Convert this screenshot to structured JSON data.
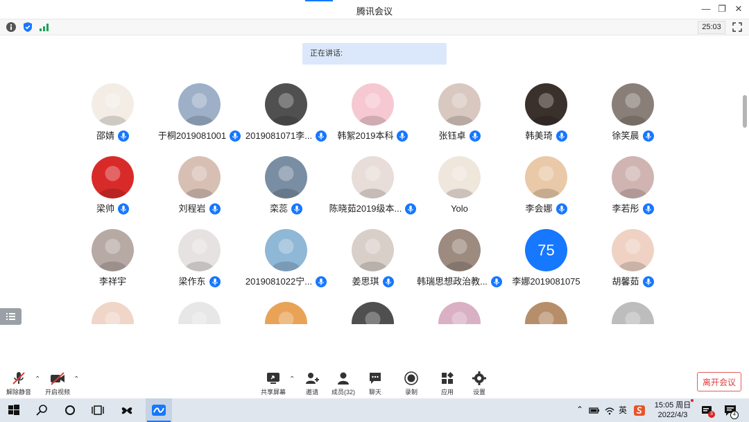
{
  "window": {
    "title": "腾讯会议"
  },
  "infobar": {
    "timer": "25:03"
  },
  "speaking": {
    "label": "正在讲话:"
  },
  "participants": [
    {
      "name": "邵婧",
      "mic": true,
      "avatar": "#f3ede6"
    },
    {
      "name": "于桐2019081001",
      "mic": true,
      "avatar": "#9db0c8"
    },
    {
      "name": "2019081071李...",
      "mic": true,
      "avatar": "#505050"
    },
    {
      "name": "韩絮2019本科",
      "mic": true,
      "avatar": "#f6c9d2"
    },
    {
      "name": "张钰卓",
      "mic": true,
      "avatar": "#d9c8c0"
    },
    {
      "name": "韩美琦",
      "mic": true,
      "avatar": "#3a302c"
    },
    {
      "name": "徐笑晨",
      "mic": true,
      "avatar": "#8a7f78"
    },
    {
      "name": "梁帅",
      "mic": true,
      "avatar": "#d92a2a"
    },
    {
      "name": "刘程岩",
      "mic": true,
      "avatar": "#d8bfb4"
    },
    {
      "name": "栾蕊",
      "mic": true,
      "avatar": "#7a8ea3"
    },
    {
      "name": "陈晓茹2019级本...",
      "mic": true,
      "avatar": "#e8ddd8"
    },
    {
      "name": "Yolo",
      "mic": false,
      "avatar": "#efe6dc"
    },
    {
      "name": "李会娜",
      "mic": true,
      "avatar": "#e9c9a8"
    },
    {
      "name": "李若彤",
      "mic": true,
      "avatar": "#cfb4b2"
    },
    {
      "name": "李祥宇",
      "mic": false,
      "avatar": "#b7aaa4"
    },
    {
      "name": "梁作东",
      "mic": true,
      "avatar": "#e7e2e2"
    },
    {
      "name": "2019081022宁...",
      "mic": true,
      "avatar": "#8fb7d6"
    },
    {
      "name": "姜思琪",
      "mic": true,
      "avatar": "#d8cfc9"
    },
    {
      "name": "韩瑞思想政治教...",
      "mic": true,
      "avatar": "#9d8b80"
    },
    {
      "name": "李娜2019081075",
      "mic": false,
      "avatar": "#1677ff",
      "initials": "75"
    },
    {
      "name": "胡馨茹",
      "mic": true,
      "avatar": "#efd2c3"
    },
    {
      "name": "",
      "mic": false,
      "avatar": "#f0d6c8"
    },
    {
      "name": "",
      "mic": false,
      "avatar": "#e7e7e7"
    },
    {
      "name": "",
      "mic": false,
      "avatar": "#e8a356"
    },
    {
      "name": "",
      "mic": false,
      "avatar": "#4f4f4f"
    },
    {
      "name": "",
      "mic": false,
      "avatar": "#d9b0c4"
    },
    {
      "name": "",
      "mic": false,
      "avatar": "#b78e6a"
    },
    {
      "name": "",
      "mic": false,
      "avatar": "#bdbdbd"
    }
  ],
  "toolbar": {
    "unmute": "解除静音",
    "video": "开启视频",
    "share": "共享屏幕",
    "invite": "邀请",
    "members": "成员(32)",
    "chat": "聊天",
    "record": "录制",
    "apps": "应用",
    "settings": "设置",
    "leave": "离开会议"
  },
  "taskbar": {
    "time": "15:05 周日",
    "date": "2022/4/3",
    "ime": "英",
    "badge_a": "3",
    "badge_b": "4"
  },
  "colors": {
    "accent": "#1677ff",
    "danger": "#e03c3c",
    "speaking_bg": "#dbe8fb"
  }
}
